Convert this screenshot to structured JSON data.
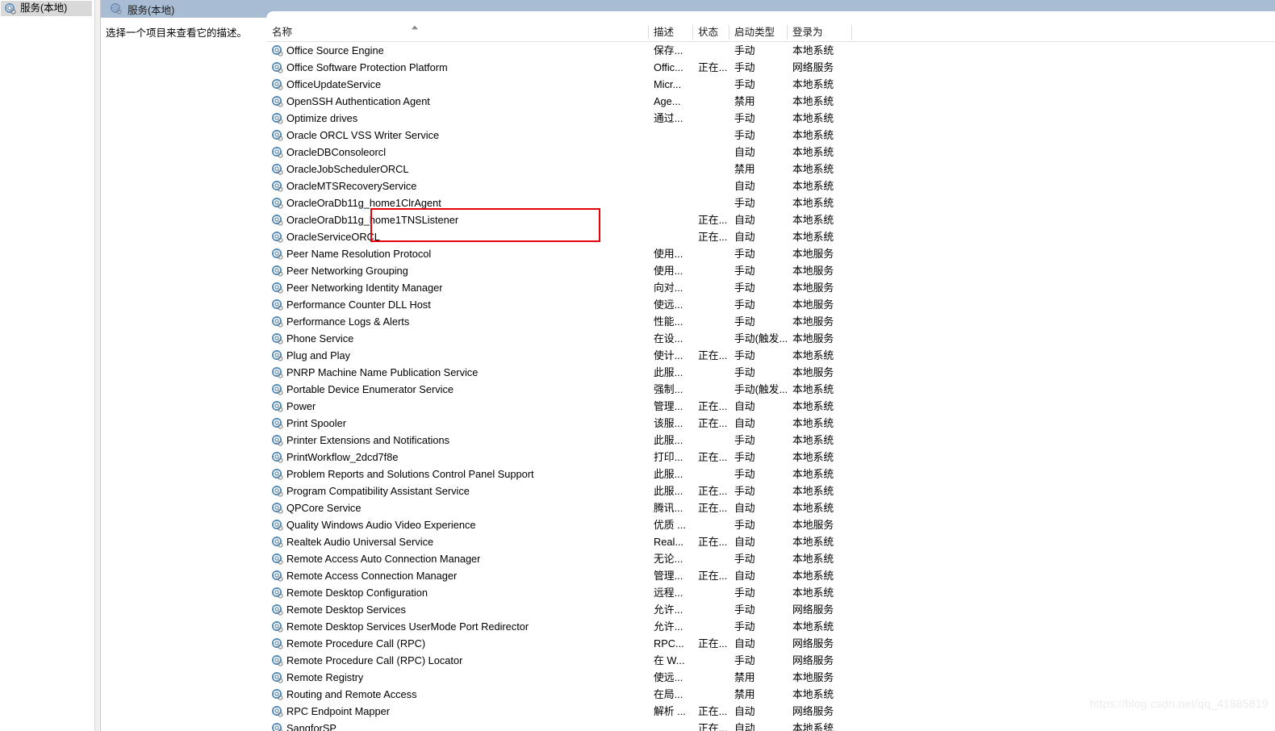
{
  "window": {
    "tree_root_label": "服务(本地)",
    "pane_title": "服务(本地)",
    "description_hint": "选择一个项目来查看它的描述。",
    "tree_icon": "services-gear-icon",
    "title_icon": "services-gear-icon"
  },
  "columns": {
    "name": "名称",
    "description": "描述",
    "status": "状态",
    "startup_type": "启动类型",
    "log_on_as": "登录为",
    "sort_indicator": "▲",
    "sort_column": "名称",
    "sort_direction": "ascending"
  },
  "colors": {
    "header_band": "#a8bcd4",
    "tree_selection": "#d9d9d9",
    "annotation_red": "#e8000d",
    "watermark": "#ececec",
    "list_background": "#ffffff"
  },
  "annotation": {
    "type": "red-rectangle",
    "highlighted_services": [
      "OracleOraDb11g_home1TNSListener",
      "OracleServiceORCL"
    ]
  },
  "watermark": "https://blog.csdn.net/qq_41885819",
  "services": [
    {
      "name": "Office  Source Engine",
      "description": "保存...",
      "status": "",
      "startup": "手动",
      "logon": "本地系统"
    },
    {
      "name": "Office Software Protection Platform",
      "description": "Offic...",
      "status": "正在...",
      "startup": "手动",
      "logon": "网络服务"
    },
    {
      "name": "OfficeUpdateService",
      "description": "Micr...",
      "status": "",
      "startup": "手动",
      "logon": "本地系统"
    },
    {
      "name": "OpenSSH Authentication Agent",
      "description": "Age...",
      "status": "",
      "startup": "禁用",
      "logon": "本地系统"
    },
    {
      "name": "Optimize drives",
      "description": "通过...",
      "status": "",
      "startup": "手动",
      "logon": "本地系统"
    },
    {
      "name": "Oracle ORCL VSS Writer Service",
      "description": "",
      "status": "",
      "startup": "手动",
      "logon": "本地系统"
    },
    {
      "name": "OracleDBConsoleorcl",
      "description": "",
      "status": "",
      "startup": "自动",
      "logon": "本地系统"
    },
    {
      "name": "OracleJobSchedulerORCL",
      "description": "",
      "status": "",
      "startup": "禁用",
      "logon": "本地系统"
    },
    {
      "name": "OracleMTSRecoveryService",
      "description": "",
      "status": "",
      "startup": "自动",
      "logon": "本地系统"
    },
    {
      "name": "OracleOraDb11g_home1ClrAgent",
      "description": "",
      "status": "",
      "startup": "手动",
      "logon": "本地系统"
    },
    {
      "name": "OracleOraDb11g_home1TNSListener",
      "description": "",
      "status": "正在...",
      "startup": "自动",
      "logon": "本地系统"
    },
    {
      "name": "OracleServiceORCL",
      "description": "",
      "status": "正在...",
      "startup": "自动",
      "logon": "本地系统"
    },
    {
      "name": "Peer Name Resolution Protocol",
      "description": "使用...",
      "status": "",
      "startup": "手动",
      "logon": "本地服务"
    },
    {
      "name": "Peer Networking Grouping",
      "description": "使用...",
      "status": "",
      "startup": "手动",
      "logon": "本地服务"
    },
    {
      "name": "Peer Networking Identity Manager",
      "description": "向对...",
      "status": "",
      "startup": "手动",
      "logon": "本地服务"
    },
    {
      "name": "Performance Counter DLL Host",
      "description": "使远...",
      "status": "",
      "startup": "手动",
      "logon": "本地服务"
    },
    {
      "name": "Performance Logs & Alerts",
      "description": "性能...",
      "status": "",
      "startup": "手动",
      "logon": "本地服务"
    },
    {
      "name": "Phone Service",
      "description": "在设...",
      "status": "",
      "startup": "手动(触发...",
      "logon": "本地服务"
    },
    {
      "name": "Plug and Play",
      "description": "使计...",
      "status": "正在...",
      "startup": "手动",
      "logon": "本地系统"
    },
    {
      "name": "PNRP Machine Name Publication Service",
      "description": "此服...",
      "status": "",
      "startup": "手动",
      "logon": "本地服务"
    },
    {
      "name": "Portable Device Enumerator Service",
      "description": "强制...",
      "status": "",
      "startup": "手动(触发...",
      "logon": "本地系统"
    },
    {
      "name": "Power",
      "description": "管理...",
      "status": "正在...",
      "startup": "自动",
      "logon": "本地系统"
    },
    {
      "name": "Print Spooler",
      "description": "该服...",
      "status": "正在...",
      "startup": "自动",
      "logon": "本地系统"
    },
    {
      "name": "Printer Extensions and Notifications",
      "description": "此服...",
      "status": "",
      "startup": "手动",
      "logon": "本地系统"
    },
    {
      "name": "PrintWorkflow_2dcd7f8e",
      "description": "打印...",
      "status": "正在...",
      "startup": "手动",
      "logon": "本地系统"
    },
    {
      "name": "Problem Reports and Solutions Control Panel Support",
      "description": "此服...",
      "status": "",
      "startup": "手动",
      "logon": "本地系统"
    },
    {
      "name": "Program Compatibility Assistant Service",
      "description": "此服...",
      "status": "正在...",
      "startup": "手动",
      "logon": "本地系统"
    },
    {
      "name": "QPCore Service",
      "description": "腾讯...",
      "status": "正在...",
      "startup": "自动",
      "logon": "本地系统"
    },
    {
      "name": "Quality Windows Audio Video Experience",
      "description": "优质 ...",
      "status": "",
      "startup": "手动",
      "logon": "本地服务"
    },
    {
      "name": "Realtek Audio Universal Service",
      "description": "Real...",
      "status": "正在...",
      "startup": "自动",
      "logon": "本地系统"
    },
    {
      "name": "Remote Access Auto Connection Manager",
      "description": "无论...",
      "status": "",
      "startup": "手动",
      "logon": "本地系统"
    },
    {
      "name": "Remote Access Connection Manager",
      "description": "管理...",
      "status": "正在...",
      "startup": "自动",
      "logon": "本地系统"
    },
    {
      "name": "Remote Desktop Configuration",
      "description": "远程...",
      "status": "",
      "startup": "手动",
      "logon": "本地系统"
    },
    {
      "name": "Remote Desktop Services",
      "description": "允许...",
      "status": "",
      "startup": "手动",
      "logon": "网络服务"
    },
    {
      "name": "Remote Desktop Services UserMode Port Redirector",
      "description": "允许...",
      "status": "",
      "startup": "手动",
      "logon": "本地系统"
    },
    {
      "name": "Remote Procedure Call (RPC)",
      "description": "RPC...",
      "status": "正在...",
      "startup": "自动",
      "logon": "网络服务"
    },
    {
      "name": "Remote Procedure Call (RPC) Locator",
      "description": "在 W...",
      "status": "",
      "startup": "手动",
      "logon": "网络服务"
    },
    {
      "name": "Remote Registry",
      "description": "使远...",
      "status": "",
      "startup": "禁用",
      "logon": "本地服务"
    },
    {
      "name": "Routing and Remote Access",
      "description": "在局...",
      "status": "",
      "startup": "禁用",
      "logon": "本地系统"
    },
    {
      "name": "RPC Endpoint Mapper",
      "description": "解析 ...",
      "status": "正在...",
      "startup": "自动",
      "logon": "网络服务"
    },
    {
      "name": "SangforSP",
      "description": "",
      "status": "正在...",
      "startup": "自动",
      "logon": "本地系统"
    }
  ]
}
